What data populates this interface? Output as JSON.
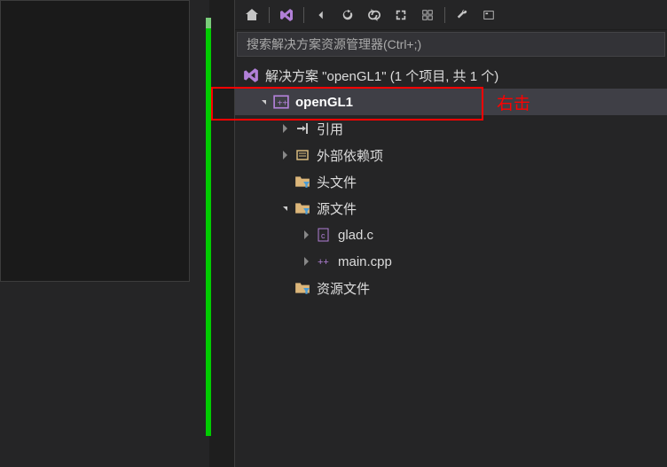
{
  "search": {
    "placeholder": "搜索解决方案资源管理器(Ctrl+;)"
  },
  "solution": {
    "label": "解决方案 \"openGL1\" (1 个项目, 共 1 个)"
  },
  "project": {
    "name": "openGL1"
  },
  "nodes": {
    "references": "引用",
    "externalDeps": "外部依赖项",
    "headerFiles": "头文件",
    "sourceFiles": "源文件",
    "resourceFiles": "资源文件"
  },
  "files": {
    "glad": "glad.c",
    "main": "main.cpp"
  },
  "annotation": {
    "text": "右击"
  }
}
